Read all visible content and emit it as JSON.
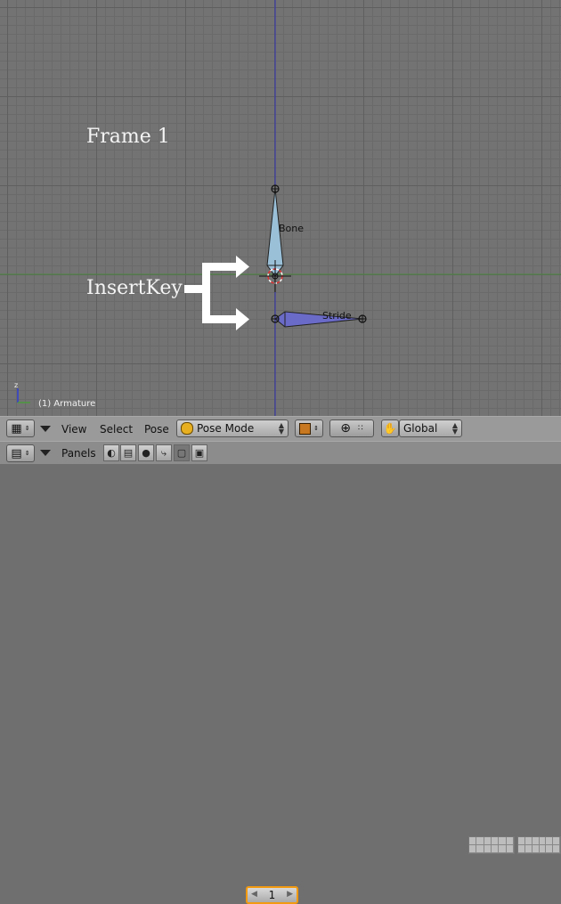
{
  "viewport": {
    "frame_label": "Frame 1",
    "insertkey_label": "InsertKey",
    "bones": [
      {
        "name": "Bone"
      },
      {
        "name": "Stride"
      }
    ],
    "status_label": "(1) Armature",
    "axis_label": "z",
    "colors": {
      "background": "#737373",
      "bone_selected": "#9ac0d8",
      "bone_other": "#6a6ac8",
      "x_axis": "#4c8a3e",
      "z_axis": "#3030b0"
    }
  },
  "header1": {
    "menus": [
      "View",
      "Select",
      "Pose"
    ],
    "mode": "Pose Mode",
    "orientation": "Global"
  },
  "header2": {
    "panels_label": "Panels",
    "frame": "1",
    "frame_highlight": "#f29a10"
  }
}
